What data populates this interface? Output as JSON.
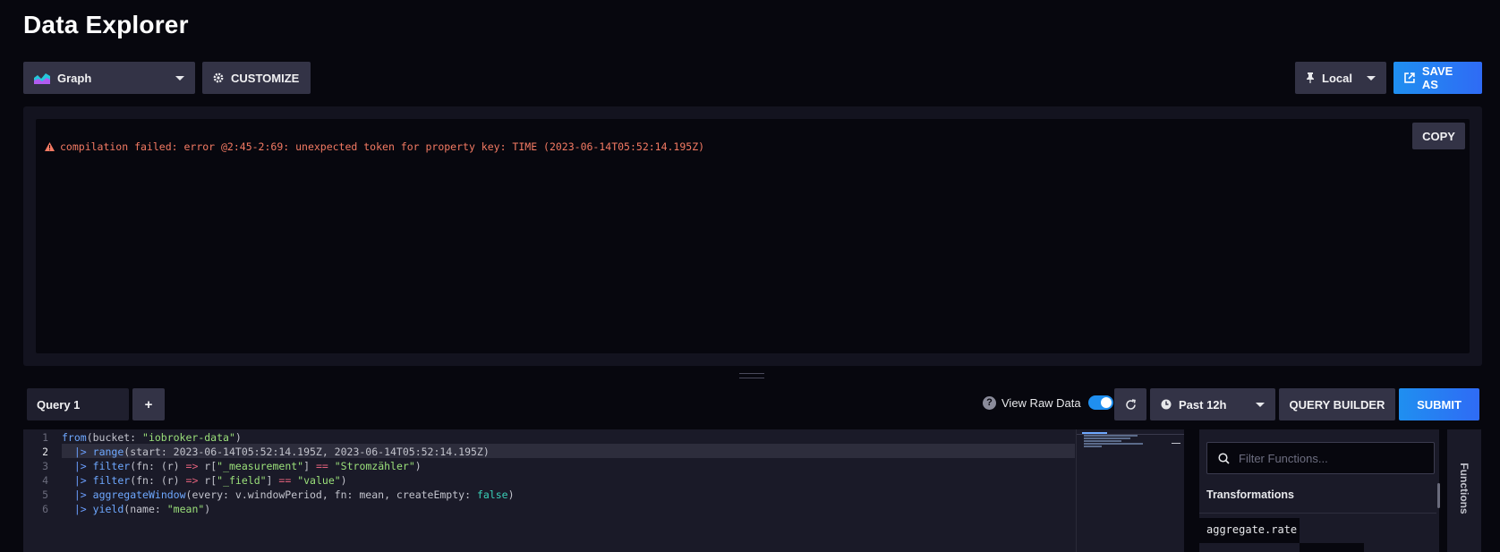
{
  "page": {
    "title": "Data Explorer"
  },
  "toolbar": {
    "viz_type": "Graph",
    "customize_label": "CUSTOMIZE",
    "timezone": "Local",
    "save_as_label": "SAVE AS"
  },
  "results": {
    "copy_label": "COPY",
    "error_message": "compilation failed: error @2:45-2:69: unexpected token for property key: TIME (2023-06-14T05:52:14.195Z)"
  },
  "query": {
    "tabs": [
      {
        "label": "Query 1"
      }
    ],
    "add_label": "+",
    "view_raw_label": "View Raw Data",
    "view_raw_enabled": true,
    "time_range": "Past 12h",
    "query_builder_label": "QUERY BUILDER",
    "submit_label": "SUBMIT"
  },
  "editor": {
    "current_line": 2,
    "lines": [
      {
        "n": "1",
        "text": "from(bucket: \"iobroker-data\")"
      },
      {
        "n": "2",
        "text": "  |> range(start: 2023-06-14T05:52:14.195Z, 2023-06-14T05:52:14.195Z)"
      },
      {
        "n": "3",
        "text": "  |> filter(fn: (r) => r[\"_measurement\"] == \"Stromzähler\")"
      },
      {
        "n": "4",
        "text": "  |> filter(fn: (r) => r[\"_field\"] == \"value\")"
      },
      {
        "n": "5",
        "text": "  |> aggregateWindow(every: v.windowPeriod, fn: mean, createEmpty: false)"
      },
      {
        "n": "6",
        "text": "  |> yield(name: \"mean\")"
      }
    ]
  },
  "functions": {
    "search_placeholder": "Filter Functions...",
    "section_title": "Transformations",
    "items": [
      "aggregate.rate"
    ],
    "tab_label": "Functions"
  },
  "colors": {
    "accent_blue": "#1f8ff0",
    "error": "#f47a63",
    "panel": "#13131f"
  }
}
